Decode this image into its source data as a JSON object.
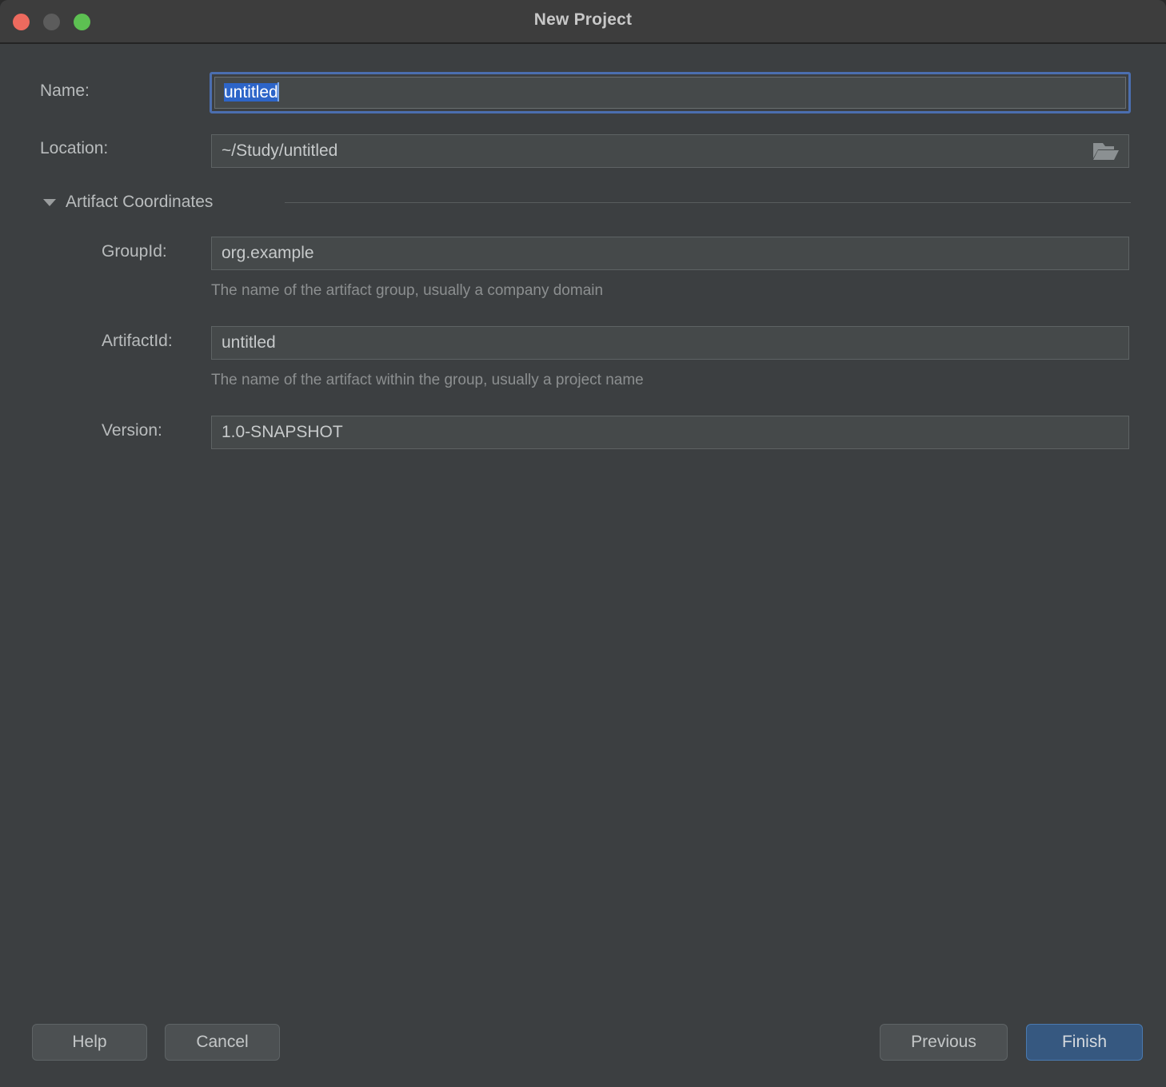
{
  "window": {
    "title": "New Project",
    "traffic_lights": [
      {
        "name": "close",
        "color": "#ed6a5e"
      },
      {
        "name": "minimize",
        "color": "#5c5c5c"
      },
      {
        "name": "zoom",
        "color": "#5dc052"
      }
    ]
  },
  "form": {
    "name": {
      "label": "Name:",
      "value": "untitled",
      "selected": true
    },
    "location": {
      "label": "Location:",
      "value": "~/Study/untitled",
      "browse_icon": "folder-open-icon"
    },
    "artifact_section": {
      "title": "Artifact Coordinates",
      "expanded": true,
      "toggle_icon": "chevron-down-icon",
      "fields": [
        {
          "label": "GroupId:",
          "value": "org.example",
          "hint": "The name of the artifact group, usually a company domain"
        },
        {
          "label": "ArtifactId:",
          "value": "untitled",
          "hint": "The name of the artifact within the group, usually a project name"
        },
        {
          "label": "Version:",
          "value": "1.0-SNAPSHOT",
          "hint": ""
        }
      ]
    }
  },
  "footer": {
    "help_label": "Help",
    "cancel_label": "Cancel",
    "previous_label": "Previous",
    "finish_label": "Finish"
  },
  "colors": {
    "background": "#3c3f41",
    "titlebar": "#3d3d3d",
    "field_bg": "#45494a",
    "accent": "#365880",
    "selection": "#2d65c8",
    "focus_ring": "#4b6eaf",
    "text": "#b9bcbd",
    "hint_text": "#8c8f90"
  }
}
